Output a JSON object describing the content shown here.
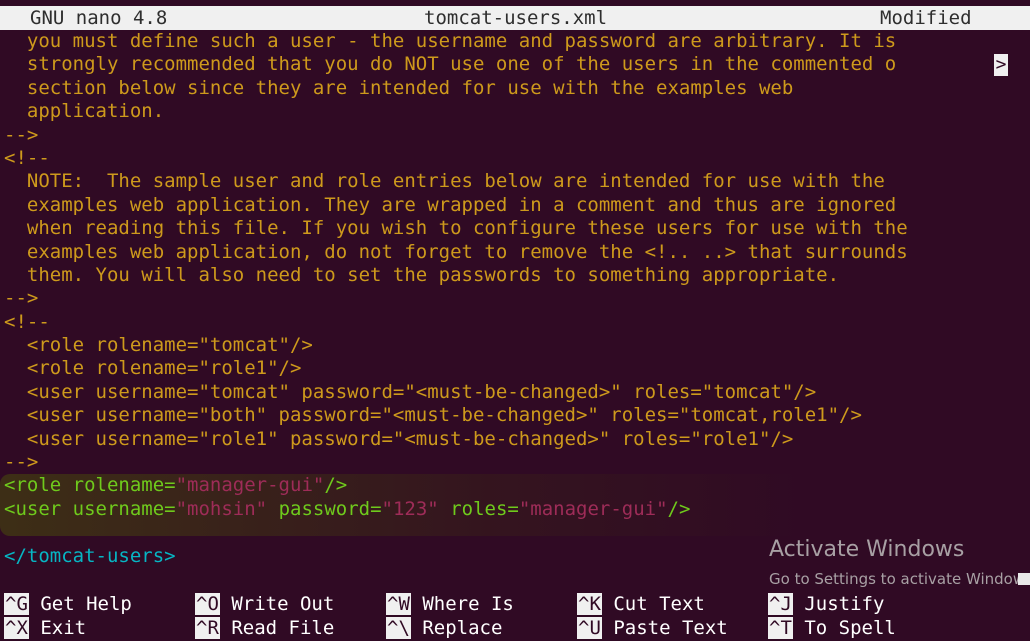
{
  "titlebar": {
    "app": "GNU nano 4.8",
    "file": "tomcat-users.xml",
    "status": "Modified"
  },
  "editor": {
    "lines": [
      "  you must define such a user - the username and password are arbitrary. It is",
      "  strongly recommended that you do NOT use one of the users in the commented o",
      "  section below since they are intended for use with the examples web",
      "  application.",
      "-->",
      "<!--",
      "  NOTE:  The sample user and role entries below are intended for use with the",
      "  examples web application. They are wrapped in a comment and thus are ignored",
      "  when reading this file. If you wish to configure these users for use with the",
      "  examples web application, do not forget to remove the <!.. ..> that surrounds",
      "  them. You will also need to set the passwords to something appropriate.",
      "-->",
      "<!--",
      "  <role rolename=\"tomcat\"/>",
      "  <role rolename=\"role1\"/>",
      "  <user username=\"tomcat\" password=\"<must-be-changed>\" roles=\"tomcat\"/>",
      "  <user username=\"both\" password=\"<must-be-changed>\" roles=\"tomcat,role1\"/>",
      "  <user username=\"role1\" password=\"<must-be-changed>\" roles=\"role1\"/>",
      "-->"
    ],
    "role_line": {
      "open": "<role",
      "attr": "rolename=",
      "value": "\"manager-gui\"",
      "close": "/>"
    },
    "user_line": {
      "open": "<user",
      "a1": "username=",
      "v1": "\"mohsin\"",
      "a2": "password=",
      "v2": "\"123\"",
      "a3": "roles=",
      "v3": "\"manager-gui\"",
      "close": "/>"
    },
    "closing_tag": "</tomcat-users>",
    "overflow_marker": ">"
  },
  "watermark": {
    "title": "Activate Windows",
    "subtitle": "Go to Settings to activate Windows."
  },
  "shortcuts": [
    {
      "key": "^G",
      "label": "Get Help"
    },
    {
      "key": "^O",
      "label": "Write Out"
    },
    {
      "key": "^W",
      "label": "Where Is"
    },
    {
      "key": "^K",
      "label": "Cut Text"
    },
    {
      "key": "^J",
      "label": "Justify"
    },
    {
      "key": "^X",
      "label": "Exit"
    },
    {
      "key": "^R",
      "label": "Read File"
    },
    {
      "key": "^\\",
      "label": "Replace"
    },
    {
      "key": "^U",
      "label": "Paste Text"
    },
    {
      "key": "^T",
      "label": "To Spell"
    }
  ],
  "colors": {
    "background": "#300a24",
    "comment": "#ce9a1c",
    "tag": "#06b6c4",
    "attr": "#6fca1c",
    "string": "#9e2c58"
  }
}
